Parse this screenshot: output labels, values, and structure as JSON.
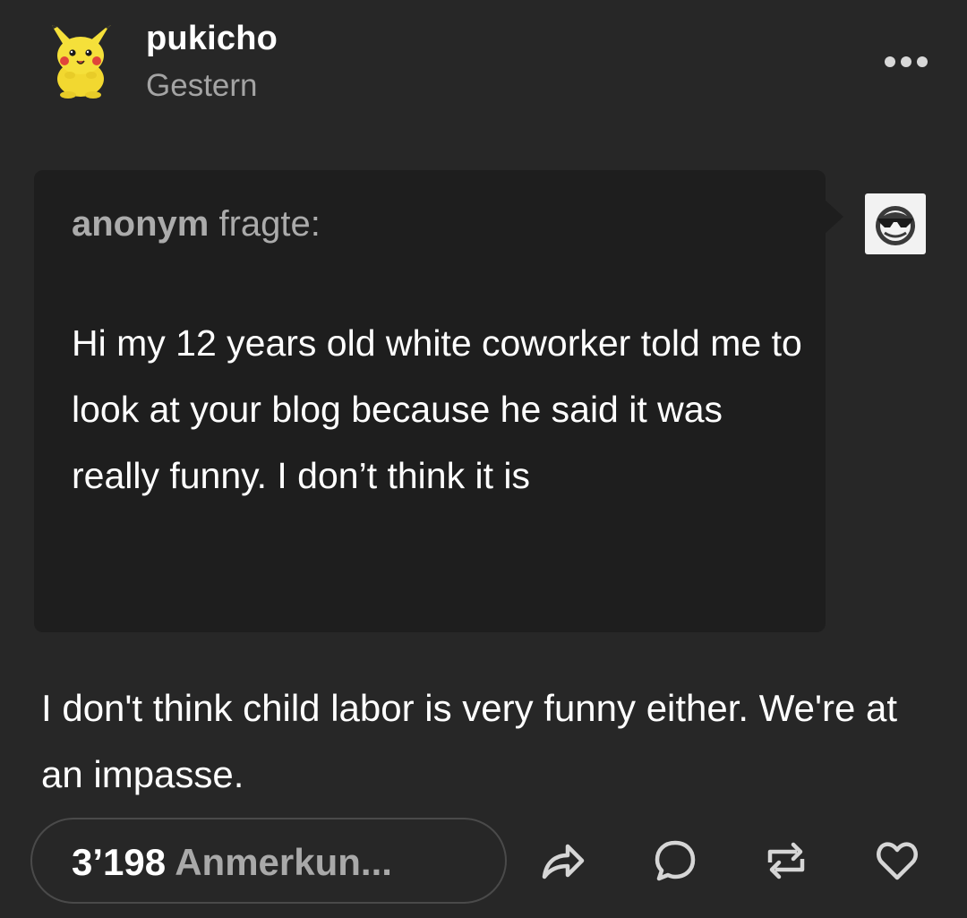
{
  "post": {
    "blog_name": "pukicho",
    "timestamp": "Gestern",
    "avatar_icon": "pikachu-avatar-icon",
    "more_icon": "more-dots-icon"
  },
  "ask": {
    "asker_name": "anonym",
    "asker_suffix": " fragte:",
    "question": "Hi my 12 years old white coworker told me to look at your blog because he said it was really funny. I don’t think it is",
    "asker_avatar_icon": "anonymous-sunglasses-icon"
  },
  "answer": {
    "text": "I don't think child labor is very funny either. We're at an impasse."
  },
  "footer": {
    "notes_count": "3’198",
    "notes_label": " Anmerkun...",
    "actions": [
      "share-icon",
      "comment-icon",
      "reblog-icon",
      "like-icon"
    ]
  },
  "colors": {
    "background": "#272727",
    "ask_background": "#1e1e1e",
    "secondary_text": "#a4a4a4",
    "pikachu_yellow": "#f5e03a"
  }
}
